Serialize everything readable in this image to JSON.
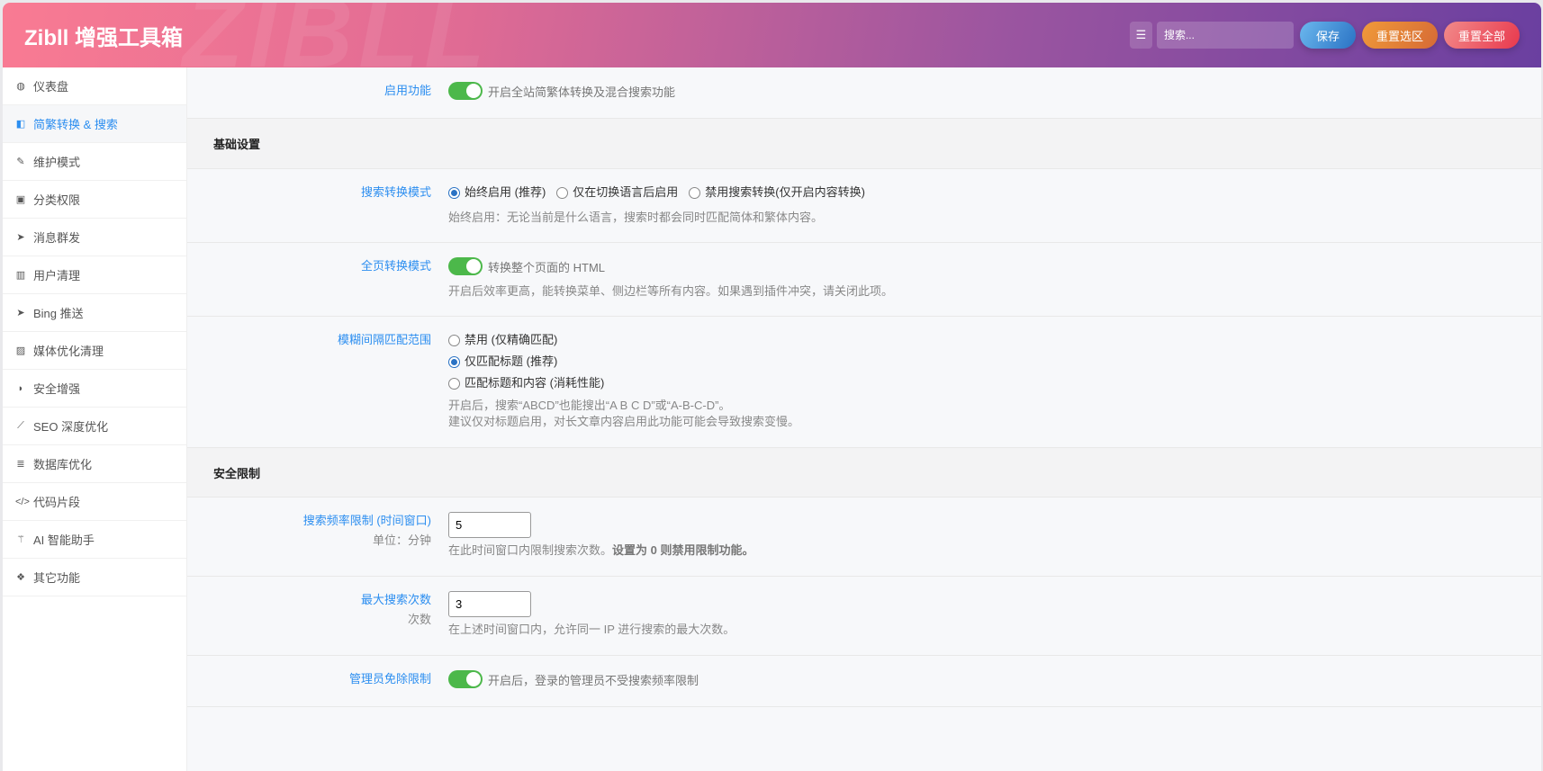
{
  "header": {
    "title": "Zibll 增强工具箱",
    "watermark": "ZIBLL",
    "search_placeholder": "搜索...",
    "save": "保存",
    "reset_section": "重置选区",
    "reset_all": "重置全部"
  },
  "sidebar": [
    {
      "label": "仪表盘",
      "icon": "dashboard-icon",
      "glyph": "◍"
    },
    {
      "label": "简繁转换 & 搜索",
      "icon": "translate-icon",
      "glyph": "◧"
    },
    {
      "label": "维护模式",
      "icon": "wrench-icon",
      "glyph": "✎"
    },
    {
      "label": "分类权限",
      "icon": "lock-icon",
      "glyph": "▣"
    },
    {
      "label": "消息群发",
      "icon": "paper-plane-icon",
      "glyph": "➤"
    },
    {
      "label": "用户清理",
      "icon": "trash-icon",
      "glyph": "▥"
    },
    {
      "label": "Bing 推送",
      "icon": "paper-plane-icon",
      "glyph": "➤"
    },
    {
      "label": "媒体优化清理",
      "icon": "image-icon",
      "glyph": "▨"
    },
    {
      "label": "安全增强",
      "icon": "shield-icon",
      "glyph": "◗"
    },
    {
      "label": "SEO 深度优化",
      "icon": "chart-line-icon",
      "glyph": "⟋"
    },
    {
      "label": "数据库优化",
      "icon": "database-icon",
      "glyph": "≣"
    },
    {
      "label": "代码片段",
      "icon": "code-icon",
      "glyph": "</>"
    },
    {
      "label": "AI 智能助手",
      "icon": "magic-wand-icon",
      "glyph": "⚚"
    },
    {
      "label": "其它功能",
      "icon": "cubes-icon",
      "glyph": "❖"
    }
  ],
  "active_index": 1,
  "main": {
    "enable": {
      "label": "启用功能",
      "on": true,
      "text": "开启全站简繁体转换及混合搜索功能"
    },
    "section1": "基础设置",
    "search_mode": {
      "label": "搜索转换模式",
      "options": [
        "始终启用 (推荐)",
        "仅在切换语言后启用",
        "禁用搜索转换(仅开启内容转换)"
      ],
      "selected": 0,
      "desc": "始终启用：无论当前是什么语言，搜索时都会同时匹配简体和繁体内容。"
    },
    "fullpage": {
      "label": "全页转换模式",
      "on": true,
      "text": "转换整个页面的 HTML",
      "desc": "开启后效率更高，能转换菜单、侧边栏等所有内容。如果遇到插件冲突，请关闭此项。"
    },
    "fuzzy": {
      "label": "模糊间隔匹配范围",
      "options": [
        "禁用 (仅精确匹配)",
        "仅匹配标题 (推荐)",
        "匹配标题和内容 (消耗性能)"
      ],
      "selected": 1,
      "desc1": "开启后，搜索“ABCD”也能搜出“A B C D”或“A-B-C-D”。",
      "desc2": "建议仅对标题启用，对长文章内容启用此功能可能会导致搜索变慢。"
    },
    "section2": "安全限制",
    "freq": {
      "label": "搜索频率限制 (时间窗口)",
      "sub": "单位：分钟",
      "value": "5",
      "desc": "在此时间窗口内限制搜索次数。",
      "desc_bold": "设置为 0 则禁用限制功能。"
    },
    "max": {
      "label": "最大搜索次数",
      "sub": "次数",
      "value": "3",
      "desc": "在上述时间窗口内，允许同一 IP 进行搜索的最大次数。"
    },
    "admin": {
      "label": "管理员免除限制",
      "on": true,
      "text": "开启后，登录的管理员不受搜索频率限制"
    }
  }
}
